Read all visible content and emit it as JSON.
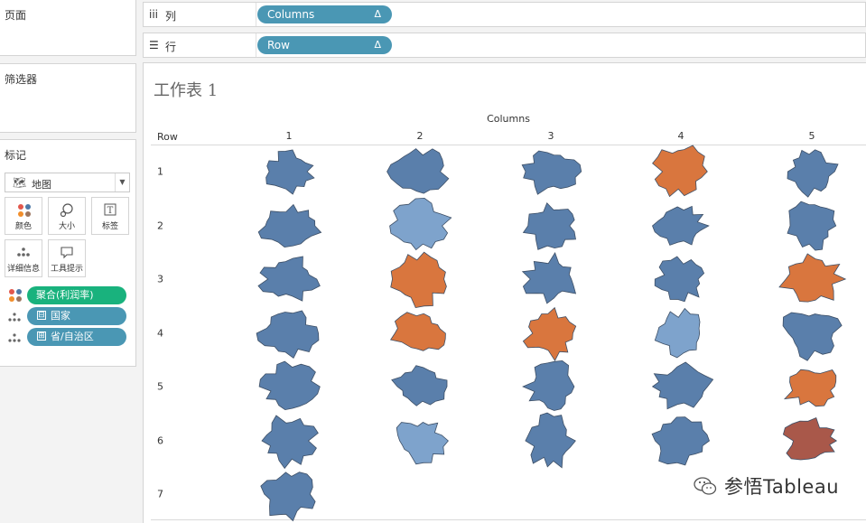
{
  "left_panel": {
    "pages_title": "页面",
    "filters_title": "筛选器",
    "marks": {
      "title": "标记",
      "mark_type": "地图",
      "buttons": [
        {
          "label": "颜色",
          "icon": "color-dots-icon"
        },
        {
          "label": "大小",
          "icon": "size-icon"
        },
        {
          "label": "标签",
          "icon": "label-icon"
        },
        {
          "label": "详细信息",
          "icon": "detail-dots-icon"
        },
        {
          "label": "工具提示",
          "icon": "tooltip-icon"
        }
      ],
      "fields": [
        {
          "label": "聚合(利润率)",
          "role": "color"
        },
        {
          "label": "国家",
          "role": "detail",
          "toggle": "⊟"
        },
        {
          "label": "省/自治区",
          "role": "detail",
          "toggle": "⊞"
        }
      ]
    }
  },
  "shelves": {
    "columns": {
      "label": "列",
      "pill": "Columns",
      "delta": "Δ"
    },
    "rows": {
      "label": "行",
      "pill": "Row",
      "delta": "Δ"
    }
  },
  "sheet": {
    "title": "工作表 1",
    "col_header": "Columns",
    "row_header": "Row",
    "col_labels": [
      "1",
      "2",
      "3",
      "4",
      "5"
    ],
    "row_labels": [
      "1",
      "2",
      "3",
      "4",
      "5",
      "6",
      "7"
    ]
  },
  "colors": {
    "blue": "#5a7fab",
    "light_blue": "#7ea3cc",
    "orange": "#d9763e",
    "dark_orange": "#a9584a",
    "pill_blue": "#4a97b4",
    "pill_green": "#19b27d"
  },
  "chart_data": {
    "type": "map",
    "grid_layout": "5 columns × 7 rows of province shapes",
    "cells": [
      {
        "row": 1,
        "col": 1,
        "color": "blue"
      },
      {
        "row": 1,
        "col": 2,
        "color": "blue"
      },
      {
        "row": 1,
        "col": 3,
        "color": "blue"
      },
      {
        "row": 1,
        "col": 4,
        "color": "orange"
      },
      {
        "row": 1,
        "col": 5,
        "color": "blue"
      },
      {
        "row": 2,
        "col": 1,
        "color": "blue"
      },
      {
        "row": 2,
        "col": 2,
        "color": "light_blue"
      },
      {
        "row": 2,
        "col": 3,
        "color": "blue"
      },
      {
        "row": 2,
        "col": 4,
        "color": "blue"
      },
      {
        "row": 2,
        "col": 5,
        "color": "blue"
      },
      {
        "row": 3,
        "col": 1,
        "color": "blue"
      },
      {
        "row": 3,
        "col": 2,
        "color": "orange"
      },
      {
        "row": 3,
        "col": 3,
        "color": "blue"
      },
      {
        "row": 3,
        "col": 4,
        "color": "blue"
      },
      {
        "row": 3,
        "col": 5,
        "color": "orange"
      },
      {
        "row": 4,
        "col": 1,
        "color": "blue"
      },
      {
        "row": 4,
        "col": 2,
        "color": "orange"
      },
      {
        "row": 4,
        "col": 3,
        "color": "orange"
      },
      {
        "row": 4,
        "col": 4,
        "color": "light_blue"
      },
      {
        "row": 4,
        "col": 5,
        "color": "blue"
      },
      {
        "row": 5,
        "col": 1,
        "color": "blue"
      },
      {
        "row": 5,
        "col": 2,
        "color": "blue"
      },
      {
        "row": 5,
        "col": 3,
        "color": "blue"
      },
      {
        "row": 5,
        "col": 4,
        "color": "blue"
      },
      {
        "row": 5,
        "col": 5,
        "color": "orange"
      },
      {
        "row": 6,
        "col": 1,
        "color": "blue"
      },
      {
        "row": 6,
        "col": 2,
        "color": "light_blue"
      },
      {
        "row": 6,
        "col": 3,
        "color": "blue"
      },
      {
        "row": 6,
        "col": 4,
        "color": "blue"
      },
      {
        "row": 6,
        "col": 5,
        "color": "dark_orange"
      },
      {
        "row": 7,
        "col": 1,
        "color": "blue"
      }
    ]
  },
  "watermark": {
    "text": "参悟Tableau",
    "icon": "wechat-icon"
  }
}
